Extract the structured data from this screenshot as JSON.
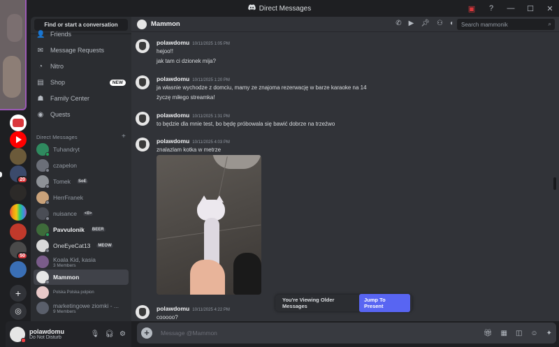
{
  "window": {
    "title": "Direct Messages"
  },
  "sidebar": {
    "find_label": "Find or start a conversation",
    "nav": [
      {
        "label": "Friends",
        "icon": "friends-icon"
      },
      {
        "label": "Message Requests",
        "icon": "mail-icon"
      },
      {
        "label": "Nitro",
        "icon": "nitro-icon"
      },
      {
        "label": "Shop",
        "icon": "shop-icon",
        "badge": "NEW"
      },
      {
        "label": "Family Center",
        "icon": "family-icon"
      },
      {
        "label": "Quests",
        "icon": "quests-icon"
      }
    ],
    "dm_header": "Direct Messages",
    "dms": [
      {
        "name": "Tuhandryt"
      },
      {
        "name": "czapelon"
      },
      {
        "name": "Tomek",
        "tag": "SoE"
      },
      {
        "name": "HerrFranek"
      },
      {
        "name": "nuisance",
        "tag": "<0>"
      },
      {
        "name": "Pavvulonik",
        "tag": "BEER"
      },
      {
        "name": "OneEyeCat13",
        "tag": "MEOW"
      },
      {
        "name": "Koala Kid, kasia",
        "sub": "3 Members"
      },
      {
        "name": "Mammon"
      },
      {
        "name": "Polska Polska polpion"
      },
      {
        "name": "marketingowe ziomki - ...",
        "sub": "9 Members"
      }
    ]
  },
  "servers": {
    "badges": [
      "20",
      "50"
    ]
  },
  "user": {
    "name": "polawdomu",
    "status": "Do Not Disturb"
  },
  "chat": {
    "channel": "Mammon",
    "search_placeholder": "Search mammonik",
    "messages": [
      {
        "author": "polawdomu",
        "time": "10/11/2025 1:05 PM",
        "lines": [
          "hejoo!!",
          "jak tam ci dzionek mija?"
        ]
      },
      {
        "author": "polawdomu",
        "time": "10/11/2025 1:20 PM",
        "lines": [
          "ja własnie wychodze z domciu, mamy ze znajoma rezerwację w barze karaoke na 14",
          "życzę miłego streamka!"
        ]
      },
      {
        "author": "polawdomu",
        "time": "10/11/2025 1:31 PM",
        "lines": [
          "to będzie dla mnie test, bo będę próbowala się bawić dobrze na trzeźwo"
        ]
      },
      {
        "author": "polawdomu",
        "time": "10/11/2025 4:03 PM",
        "lines": [
          "znalazlam kotka w metrze"
        ]
      },
      {
        "author": "polawdomu",
        "time": "10/11/2025 4:22 PM",
        "lines": [
          "cooooo?"
        ]
      }
    ],
    "older_notice": "You're Viewing Older Messages",
    "jump_label": "Jump To Present",
    "composer_placeholder": "Message @Mammon"
  },
  "colors": {
    "accent": "#5865f2",
    "background": "#313338",
    "sidebar": "#2b2d31",
    "rail": "#1e1f22"
  }
}
